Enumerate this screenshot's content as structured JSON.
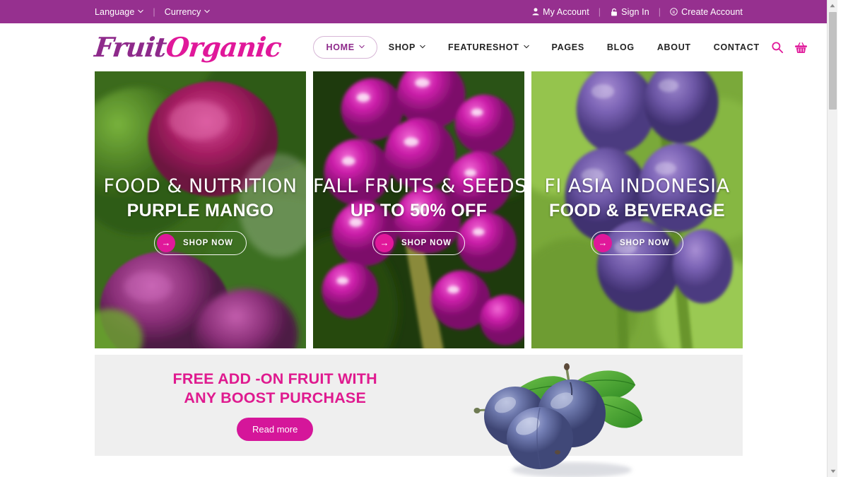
{
  "topbar": {
    "language": "Language",
    "currency": "Currency",
    "my_account": "My Account",
    "sign_in": "Sign In",
    "create_account": "Create Account",
    "bg_color": "#96308f",
    "icons": {
      "account": "user-icon",
      "signin": "lock-icon",
      "create": "registered-icon",
      "caret": "chevron-down-icon"
    }
  },
  "header": {
    "logo_part1": "Fruit",
    "logo_part2": "Organic",
    "logo_color1": "#8e2a8b",
    "logo_color2": "#e0189a",
    "nav": [
      {
        "label": "HOME",
        "active": true,
        "caret": true
      },
      {
        "label": "SHOP",
        "active": false,
        "caret": true
      },
      {
        "label": "FEATURESHOT",
        "active": false,
        "caret": true
      },
      {
        "label": "PAGES",
        "active": false,
        "caret": false
      },
      {
        "label": "BLOG",
        "active": false,
        "caret": false
      },
      {
        "label": "ABOUT",
        "active": false,
        "caret": false
      },
      {
        "label": "CONTACT",
        "active": false,
        "caret": false
      }
    ],
    "search_icon": "search-icon",
    "cart_icon": "shopping-basket-icon",
    "icon_color": "#e0189a"
  },
  "banners": [
    {
      "line1": "FOOD & NUTRITION",
      "line2": "PURPLE MANGO",
      "cta": "SHOP NOW",
      "arrow": "→",
      "theme": "b1"
    },
    {
      "line1": "FALL FRUITS & SEEDS",
      "line2": "UP TO 50% OFF",
      "cta": "SHOP NOW",
      "arrow": "→",
      "theme": "b2"
    },
    {
      "line1": "FI ASIA INDONESIA",
      "line2": "FOOD & BEVERAGE",
      "cta": "SHOP NOW",
      "arrow": "→",
      "theme": "b3"
    }
  ],
  "promo": {
    "heading_line1": "FREE ADD -ON FRUIT WITH",
    "heading_line2": "ANY BOOST PURCHASE",
    "button": "Read more",
    "heading_color": "#df1a8f",
    "button_color": "#d5169a",
    "background": "#efefef",
    "image": "plums-image"
  },
  "scrollbar": {
    "up_arrow": "scroll-up-arrow",
    "down_arrow": "scroll-down-arrow"
  }
}
